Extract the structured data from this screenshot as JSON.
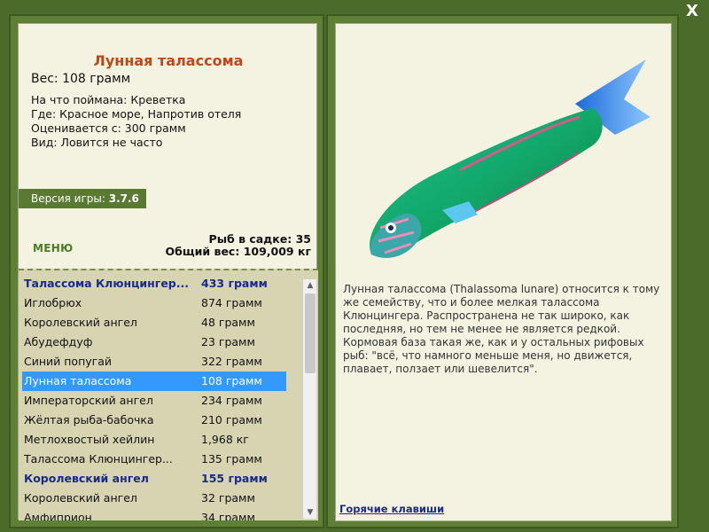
{
  "close_label": "X",
  "fish": {
    "title": "Лунная талассома",
    "weight": "Вес: 108 грамм",
    "details": [
      {
        "label": "На что поймана:",
        "value": "Креветка"
      },
      {
        "label": "Где:",
        "value": "Красное море, Напротив отеля"
      },
      {
        "label": "Оценивается с:",
        "value": "300 грамм"
      },
      {
        "label": "Вид:",
        "value": "Ловится не часто"
      }
    ],
    "description": "Лунная талассома (Thalassoma lunare) относится к тому же семейству, что и более мелкая талассома Клюнцингера. Распространена не так широко, как последняя, но тем не менее не является редкой. Кормовая база такая же, как и у остальных рифовых рыб: \"всё, что намного меньше меня, но движется, плавает, ползает или шевелится\"."
  },
  "version": {
    "label": "Версия игры:",
    "value": "3.7.6"
  },
  "menu_label": "МЕНЮ",
  "cage": {
    "count_label": "Рыб в садке: 35",
    "total_label": "Общий вес: 109,009 кг"
  },
  "fish_list": [
    {
      "name": "Талассома Клюнцингер...",
      "amount": "433 грамм",
      "bold": true,
      "selected": false
    },
    {
      "name": "Иглобрюх",
      "amount": "874 грамм",
      "bold": false,
      "selected": false
    },
    {
      "name": "Королевский ангел",
      "amount": "48 грамм",
      "bold": false,
      "selected": false
    },
    {
      "name": "Абудефдуф",
      "amount": "23 грамм",
      "bold": false,
      "selected": false
    },
    {
      "name": "Синий попугай",
      "amount": "322 грамм",
      "bold": false,
      "selected": false
    },
    {
      "name": "Лунная талассома",
      "amount": "108 грамм",
      "bold": false,
      "selected": true
    },
    {
      "name": "Императорский ангел",
      "amount": "234 грамм",
      "bold": false,
      "selected": false
    },
    {
      "name": "Жёлтая рыба-бабочка",
      "amount": "210 грамм",
      "bold": false,
      "selected": false
    },
    {
      "name": "Метлохвостый хейлин",
      "amount": "1,968 кг",
      "bold": false,
      "selected": false
    },
    {
      "name": "Талассома Клюнцингер...",
      "amount": "135 грамм",
      "bold": false,
      "selected": false
    },
    {
      "name": "Королевский ангел",
      "amount": "155 грамм",
      "bold": true,
      "selected": false
    },
    {
      "name": "Королевский ангел",
      "amount": "32 грамм",
      "bold": false,
      "selected": false
    },
    {
      "name": "Амфиприон",
      "amount": "34 грамм",
      "bold": false,
      "selected": false
    }
  ],
  "hotkeys_label": "Горячие клавиши",
  "colors": {
    "title": "#c0461a",
    "frame": "#5f7f36",
    "panel": "#f4f3e2",
    "list_bg": "#d7d4b2",
    "selected": "#3399ff",
    "bold_row": "#1a2a8a"
  }
}
